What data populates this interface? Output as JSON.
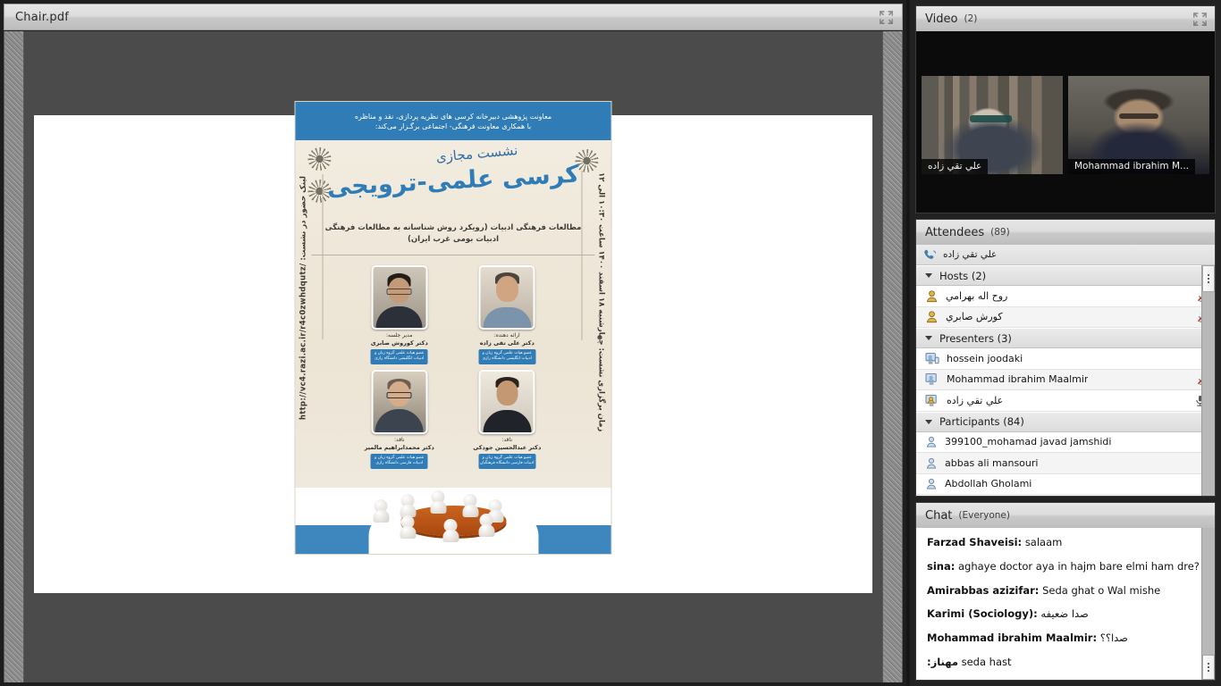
{
  "share_pod": {
    "title": "Chair.pdf",
    "expand_icon": "expand-arrows-icon",
    "poster": {
      "header_line1": "معاونت پژوهشی دبیرخانه کرسی های نظریه پردازی، نقد و مناظره",
      "header_line2": "با همکاری معاونت فرهنگی- اجتماعی برگـزار می‌کند:",
      "script_small": "نشست مجازی",
      "script_big": "کرسی علمی-ترویجی",
      "subject_line1": "مطالعات فرهنگی ادبیات (رویکرد روش شناسانه به مطالعات فرهنگی",
      "subject_line2": "ادبیات بومی غرب ایران)",
      "left_label": "لینک حضور در نشست:",
      "left_url": "http://vc4.razi.ac.ir/r4c0zwhdqutz/",
      "right_label": "زمان برگزاری نشست:",
      "right_detail": "چهارشنبه ۱۸ اسفند ۱۴۰۰ ساعت ۱۰:۳۰ الی ۱۲",
      "people": [
        {
          "role": "مدیر جلسه:",
          "name": "دکتر کوروش صابری",
          "affiliation": "عضو هیات علمی گروه زبان و ادبیات انگلیسی دانشگاه رازی"
        },
        {
          "role": "ارائه دهنده:",
          "name": "دکتر علی تقی زاده",
          "affiliation": "عضو هیات علمی گروه زبان و ادبیات انگلیسی دانشگاه رازی"
        },
        {
          "role": "ناقد:",
          "name": "دکتر محمدابراهیم مالمیر",
          "affiliation": "عضو هیات علمی گروه زبان و ادبیات فارسی دانشگاه رازی"
        },
        {
          "role": "ناقد:",
          "name": "دکتر عبدالحسین جودکی",
          "affiliation": "عضو هیات علمی گروه زبان و ادبیات فارسی دانشگاه فرهنگیان"
        }
      ]
    }
  },
  "video_pod": {
    "title": "Video",
    "count": "(2)",
    "expand_icon": "expand-arrows-icon",
    "tiles": [
      {
        "label": "علي تقي زاده",
        "rtl": true
      },
      {
        "label": "Mohammad  ibrahim M...",
        "rtl": false
      }
    ]
  },
  "attendees_pod": {
    "title": "Attendees",
    "count": "(89)",
    "self": {
      "name": "علي تقي زاده",
      "icon": "phone-icon"
    },
    "groups": [
      {
        "label": "Hosts (2)",
        "caret_icon": "caret-down-icon",
        "rows": [
          {
            "name": "روح اله بهرامي",
            "rtl": true,
            "icon": "host-icon",
            "status": "mic-muted-icon"
          },
          {
            "name": "كورش صابري",
            "rtl": true,
            "icon": "host-icon",
            "status": "mic-muted-icon"
          }
        ]
      },
      {
        "label": "Presenters (3)",
        "caret_icon": "caret-down-icon",
        "rows": [
          {
            "name": "hossein joodaki",
            "rtl": false,
            "icon": "presenter-icon",
            "status": "none"
          },
          {
            "name": "Mohammad  ibrahim Maalmir",
            "rtl": false,
            "icon": "presenter-icon",
            "status": "mic-muted-icon"
          },
          {
            "name": "علي تقي زاده",
            "rtl": true,
            "icon": "presenter-icon",
            "status": "mic-active-icon"
          }
        ]
      },
      {
        "label": "Participants (84)",
        "caret_icon": "caret-down-icon",
        "rows": [
          {
            "name": "399100_mohamad javad jamshidi",
            "rtl": false,
            "icon": "participant-icon",
            "status": "none"
          },
          {
            "name": "abbas ali mansouri",
            "rtl": false,
            "icon": "participant-icon",
            "status": "none"
          },
          {
            "name": "Abdollah Gholami",
            "rtl": false,
            "icon": "participant-icon",
            "status": "none"
          }
        ]
      }
    ]
  },
  "chat_pod": {
    "title": "Chat",
    "count": "(Everyone)",
    "messages": [
      {
        "who": "Farzad Shaveisi:",
        "who_rtl": false,
        "text": "salaam",
        "text_rtl": false
      },
      {
        "who": "sina:",
        "who_rtl": false,
        "text": "aghaye doctor aya in hajm bare elmi ham dre?",
        "text_rtl": false
      },
      {
        "who": "Amirabbas azizifar:",
        "who_rtl": false,
        "text": "Seda ghat  o Wal mishe",
        "text_rtl": false
      },
      {
        "who": "Karimi (Sociology):",
        "who_rtl": false,
        "text": "صدا ضعيفه",
        "text_rtl": true
      },
      {
        "who": "Mohammad  ibrahim Maalmir:",
        "who_rtl": false,
        "text": "صدا؟؟",
        "text_rtl": true
      },
      {
        "who": "مهناز:",
        "who_rtl": true,
        "text": "seda hast",
        "text_rtl": false
      }
    ]
  },
  "colors": {
    "poster_blue": "#2f7cb6",
    "pod_chrome": "#dcdcdc",
    "app_bg": "#222222",
    "mic_muted": "#c0392b"
  }
}
